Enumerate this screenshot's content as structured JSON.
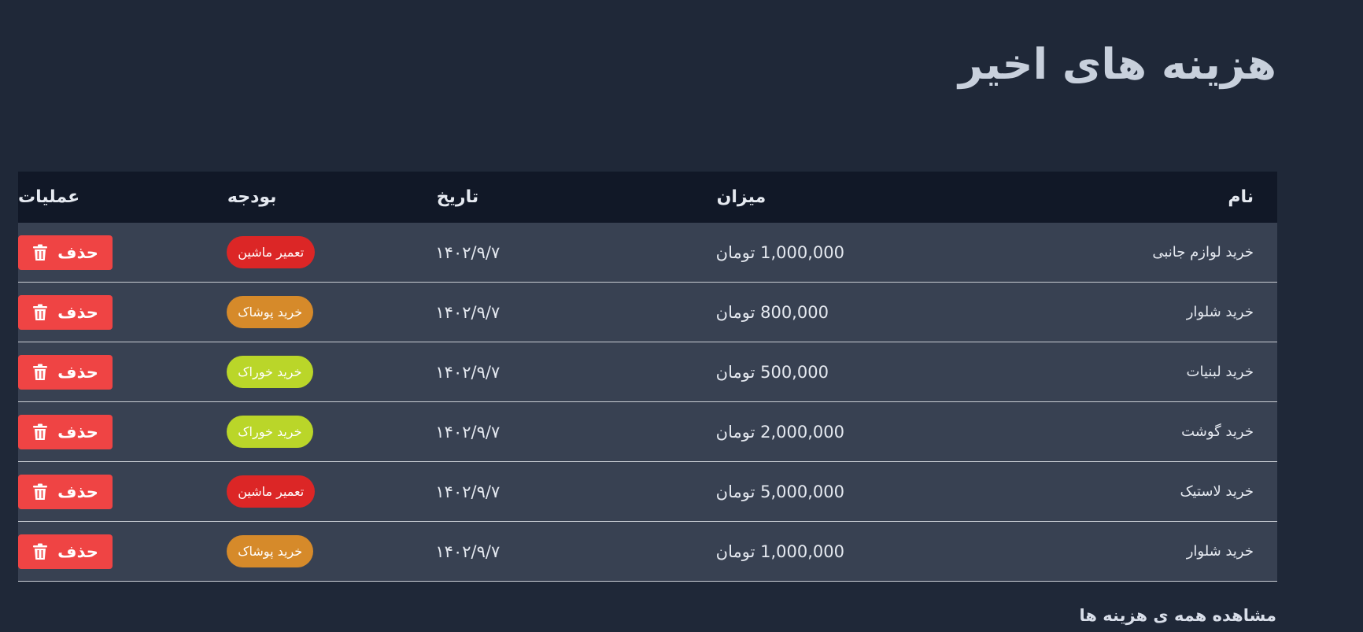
{
  "page_title": "هزینه های اخیر",
  "table": {
    "headers": {
      "name": "نام",
      "amount": "میزان",
      "date": "تاریخ",
      "budget": "بودجه",
      "operations": "عملیات"
    },
    "rows": [
      {
        "name": "خرید لوازم جانبی",
        "amount": "1,000,000 تومان",
        "date": "۱۴۰۲/۹/۷",
        "budget": "تعمیر ماشین",
        "budget_color": "#dc2626",
        "delete_label": "حذف"
      },
      {
        "name": "خرید شلوار",
        "amount": "800,000 تومان",
        "date": "۱۴۰۲/۹/۷",
        "budget": "خرید پوشاک",
        "budget_color": "#d68a2a",
        "delete_label": "حذف"
      },
      {
        "name": "خرید لبنیات",
        "amount": "500,000 تومان",
        "date": "۱۴۰۲/۹/۷",
        "budget": "خرید خوراک",
        "budget_color": "#bad629",
        "delete_label": "حذف"
      },
      {
        "name": "خرید گوشت",
        "amount": "2,000,000 تومان",
        "date": "۱۴۰۲/۹/۷",
        "budget": "خرید خوراک",
        "budget_color": "#bad629",
        "delete_label": "حذف"
      },
      {
        "name": "خرید لاستیک",
        "amount": "5,000,000 تومان",
        "date": "۱۴۰۲/۹/۷",
        "budget": "تعمیر ماشین",
        "budget_color": "#dc2626",
        "delete_label": "حذف"
      },
      {
        "name": "خرید شلوار",
        "amount": "1,000,000 تومان",
        "date": "۱۴۰۲/۹/۷",
        "budget": "خرید پوشاک",
        "budget_color": "#d68a2a",
        "delete_label": "حذف"
      }
    ]
  },
  "view_all_link": "مشاهده همه ی هزینه ها",
  "icons": {
    "delete": "trash-icon"
  },
  "colors": {
    "background": "#1f2838",
    "header_row": "#111827",
    "row": "#384152",
    "delete_button": "#ef4444"
  }
}
